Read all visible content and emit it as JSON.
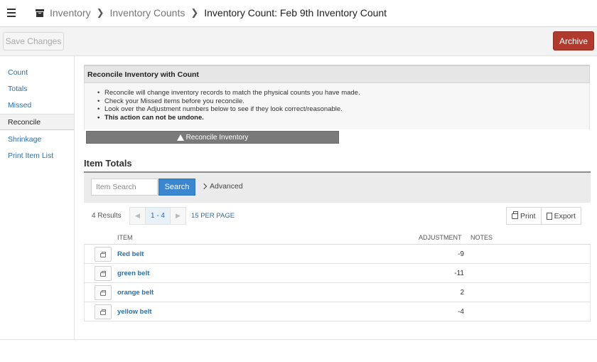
{
  "breadcrumb": {
    "items": [
      "Inventory",
      "Inventory Counts"
    ],
    "current": "Inventory Count: Feb 9th Inventory Count"
  },
  "toolbar": {
    "save_label": "Save Changes",
    "archive_label": "Archive",
    "archive_color": "#b03a2e"
  },
  "sidebar": {
    "items": [
      {
        "label": "Count"
      },
      {
        "label": "Totals"
      },
      {
        "label": "Missed"
      },
      {
        "label": "Reconcile"
      },
      {
        "label": "Shrinkage"
      },
      {
        "label": "Print Item List"
      }
    ],
    "active": "Reconcile"
  },
  "reconcile": {
    "title": "Reconcile Inventory with Count",
    "notes": [
      "Reconcile will change inventory records to match the physical counts you have made.",
      "Check your Missed items before you reconcile.",
      "Look over the Adjustment numbers below to see if they look correct/reasonable.",
      "This action can not be undone."
    ],
    "button_label": "Reconcile Inventory",
    "button_icon": "warning-icon"
  },
  "item_totals": {
    "title": "Item Totals",
    "search": {
      "placeholder": "Item Search",
      "button_label": "Search",
      "advanced_label": "Advanced"
    },
    "results_label": "4 Results",
    "page_range": "1 - 4",
    "per_page": "15 PER PAGE",
    "print_label": "Print",
    "export_label": "Export",
    "columns": {
      "item": "ITEM",
      "adjustment": "ADJUSTMENT",
      "notes": "NOTES"
    },
    "rows": [
      {
        "name": "Red belt",
        "adjustment": "-9",
        "notes": ""
      },
      {
        "name": "green belt",
        "adjustment": "-11",
        "notes": ""
      },
      {
        "name": "orange belt",
        "adjustment": "2",
        "notes": ""
      },
      {
        "name": "yellow belt",
        "adjustment": "-4",
        "notes": ""
      }
    ]
  }
}
